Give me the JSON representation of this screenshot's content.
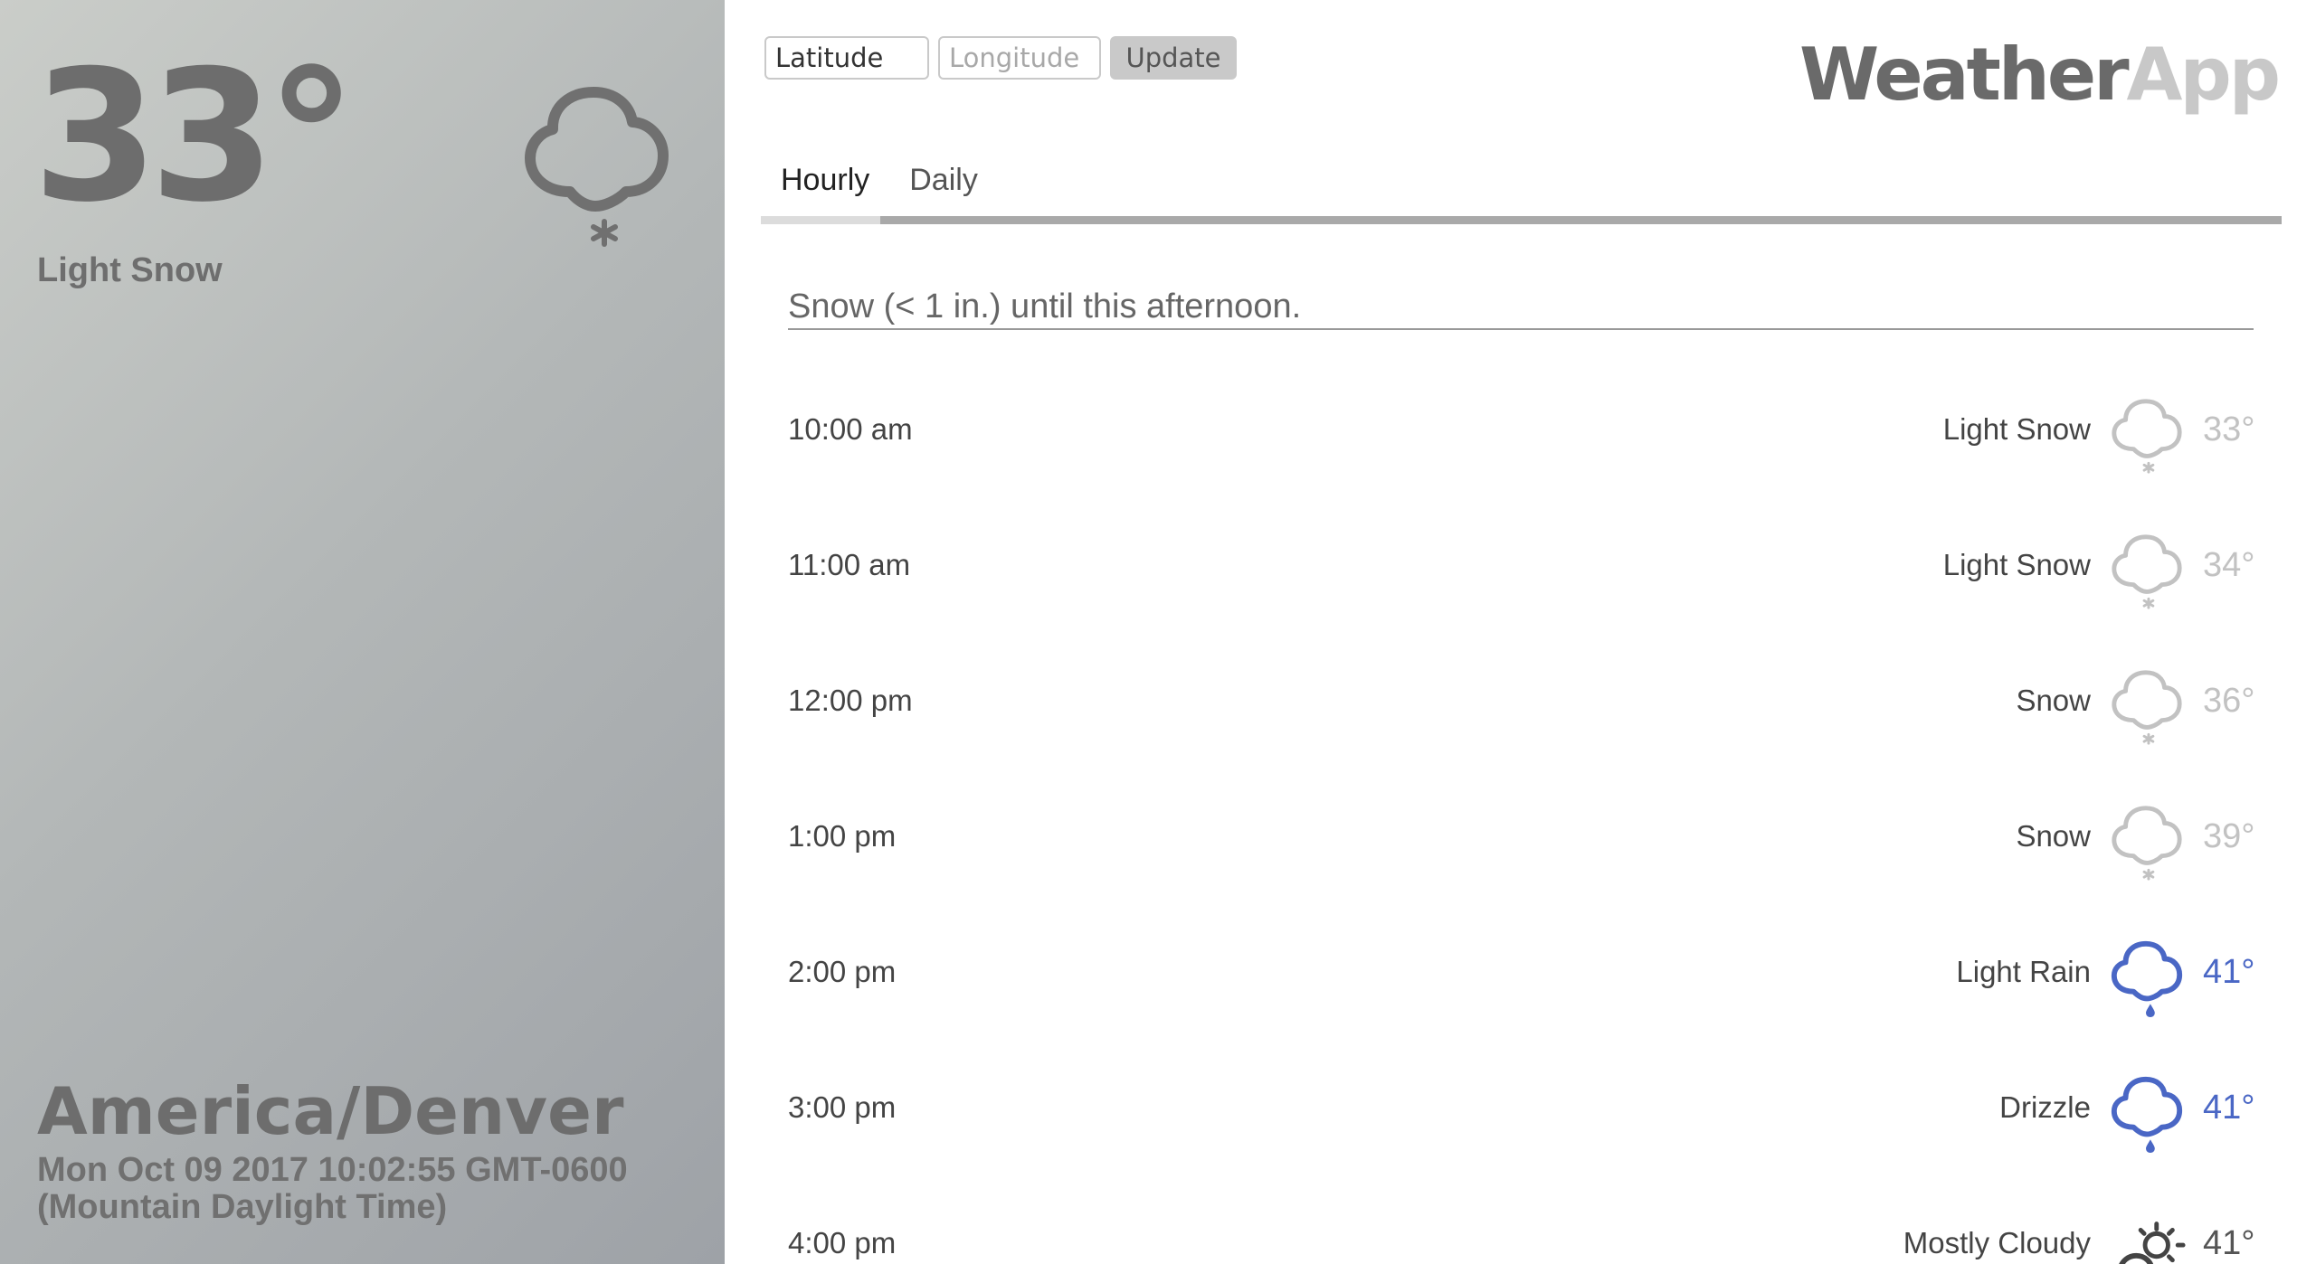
{
  "current": {
    "temperature": "33°",
    "summary": "Light Snow",
    "icon": "snow-cloud-icon",
    "timezone": "America/Denver",
    "datetime": "Mon Oct 09 2017 10:02:55 GMT-0600 (Mountain Daylight Time)"
  },
  "location_form": {
    "latitude_placeholder": "Latitude",
    "longitude_placeholder": "Longitude",
    "update_label": "Update"
  },
  "logo": {
    "part1": "Weather",
    "part2": "App"
  },
  "tabs": [
    {
      "label": "Hourly",
      "active": true
    },
    {
      "label": "Daily",
      "active": false
    }
  ],
  "hourly_summary": "Snow (< 1 in.) until this afternoon.",
  "hourly": [
    {
      "time": "10:00 am",
      "summary": "Light Snow",
      "temp": "33°",
      "icon": "snow-cloud-icon"
    },
    {
      "time": "11:00 am",
      "summary": "Light Snow",
      "temp": "34°",
      "icon": "snow-cloud-icon"
    },
    {
      "time": "12:00 pm",
      "summary": "Snow",
      "temp": "36°",
      "icon": "snow-cloud-icon"
    },
    {
      "time": "1:00 pm",
      "summary": "Snow",
      "temp": "39°",
      "icon": "snow-cloud-icon"
    },
    {
      "time": "2:00 pm",
      "summary": "Light Rain",
      "temp": "41°",
      "icon": "rain-cloud-icon"
    },
    {
      "time": "3:00 pm",
      "summary": "Drizzle",
      "temp": "41°",
      "icon": "rain-cloud-icon"
    },
    {
      "time": "4:00 pm",
      "summary": "Mostly Cloudy",
      "temp": "41°",
      "icon": "partly-cloudy-icon"
    }
  ],
  "colors": {
    "snow": "#c2c2c2",
    "rain": "#4a67c5",
    "cloudy": "#555555",
    "panel_gradient_start": "#cacdc9",
    "panel_gradient_end": "#9ea2a7"
  }
}
